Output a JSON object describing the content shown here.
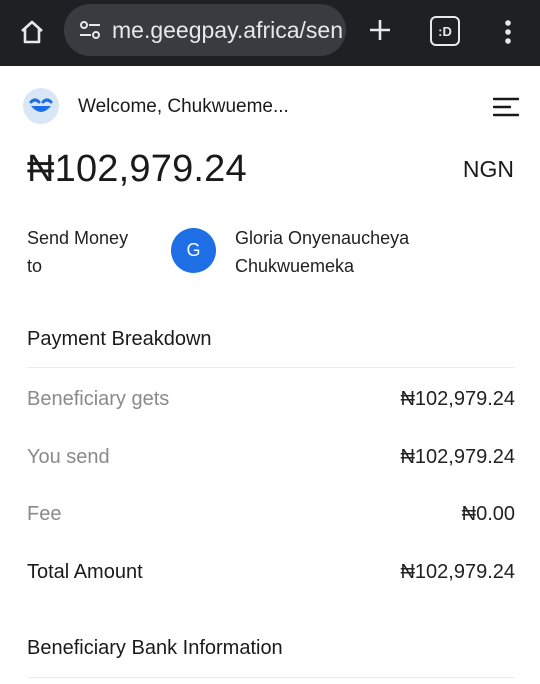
{
  "browser": {
    "url": "me.geegpay.africa/sen",
    "tabs_label": ":D"
  },
  "header": {
    "welcome": "Welcome, Chukwueme..."
  },
  "balance": {
    "amount": "₦102,979.24",
    "currency": "NGN"
  },
  "send": {
    "label_line1": "Send Money",
    "label_line2": "to",
    "recipient_initial": "G",
    "recipient_line1": "Gloria Onyenaucheya",
    "recipient_line2": "Chukwuemeka"
  },
  "breakdown": {
    "title": "Payment Breakdown",
    "rows": [
      {
        "label": "Beneficiary gets",
        "value": "₦102,979.24"
      },
      {
        "label": "You send",
        "value": "₦102,979.24"
      },
      {
        "label": "Fee",
        "value": "₦0.00"
      },
      {
        "label": "Total Amount",
        "value": "₦102,979.24"
      }
    ]
  },
  "bank": {
    "title": "Beneficiary Bank Information"
  },
  "colors": {
    "browser_bg": "#1f2024",
    "accent": "#1e6fe6",
    "muted_text": "#8a8a8a"
  }
}
